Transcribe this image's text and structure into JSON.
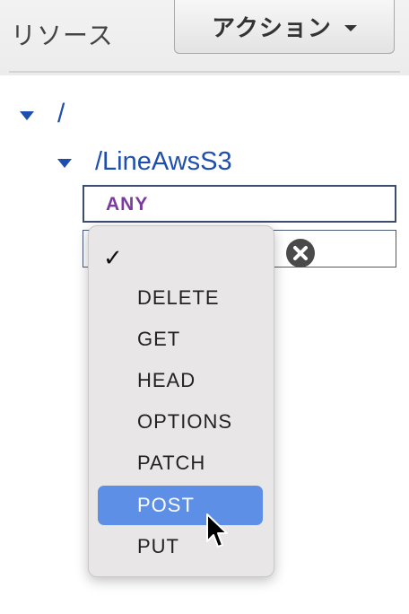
{
  "header": {
    "title": "リソース",
    "actions_label": "アクション"
  },
  "tree": {
    "root_label": "/",
    "resource_label": "/LineAwsS3",
    "methods": [
      {
        "label": "ANY",
        "color": "#7a3a9e"
      }
    ],
    "new_method_value": ""
  },
  "dropdown": {
    "checked_option": "",
    "checkmark": "✓",
    "options": [
      "DELETE",
      "GET",
      "HEAD",
      "OPTIONS",
      "PATCH",
      "POST",
      "PUT"
    ],
    "highlighted": "POST"
  },
  "icons": {
    "caret": "caret-down-icon",
    "clear": "clear-circle-x-icon",
    "cursor": "mouse-pointer-icon",
    "tree_toggle": "triangle-down-icon"
  },
  "colors": {
    "link": "#1f4fae",
    "highlight": "#5d8fe6",
    "method_any": "#7a3a9e"
  }
}
